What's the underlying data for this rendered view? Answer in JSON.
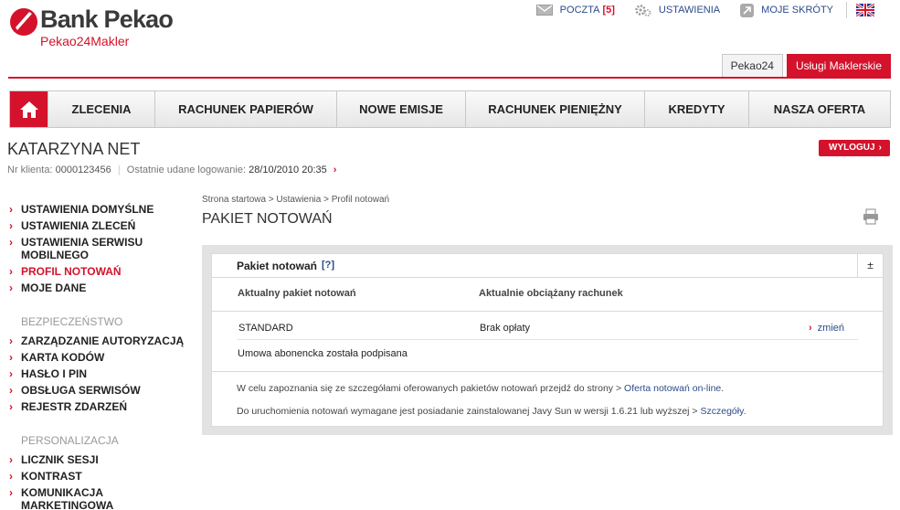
{
  "brand": {
    "name": "Bank Pekao",
    "subtitle": "Pekao24Makler",
    "color": "#d4122b"
  },
  "top_links": {
    "mail_label": "POCZTA",
    "mail_count": "[5]",
    "settings_label": "USTAWIENIA",
    "shortcuts_label": "MOJE SKRÓTY"
  },
  "site_tabs": [
    {
      "label": "Pekao24",
      "active": false
    },
    {
      "label": "Usługi Maklerskie",
      "active": true
    }
  ],
  "main_nav": [
    "ZLECENIA",
    "RACHUNEK PAPIERÓW",
    "NOWE EMISJE",
    "RACHUNEK PIENIĘŻNY",
    "KREDYTY",
    "NASZA OFERTA"
  ],
  "user": {
    "name": "KATARZYNA NET",
    "client_label": "Nr klienta:",
    "client_no": "0000123456",
    "last_login_label": "Ostatnie udane logowanie:",
    "last_login": "28/10/2010 20:35",
    "logout_label": "WYLOGUJ"
  },
  "sidebar": {
    "settings_items": [
      {
        "label": "USTAWIENIA DOMYŚLNE",
        "active": false
      },
      {
        "label": "USTAWIENIA ZLECEŃ",
        "active": false
      },
      {
        "label": "USTAWIENIA SERWISU MOBILNEGO",
        "active": false
      },
      {
        "label": "PROFIL NOTOWAŃ",
        "active": true
      },
      {
        "label": "MOJE DANE",
        "active": false
      }
    ],
    "security_heading": "BEZPIECZEŃSTWO",
    "security_items": [
      "ZARZĄDZANIE AUTORYZACJĄ",
      "KARTA KODÓW",
      "HASŁO I PIN",
      "OBSŁUGA SERWISÓW",
      "REJESTR ZDARZEŃ"
    ],
    "personal_heading": "PERSONALIZACJA",
    "personal_items": [
      "LICZNIK SESJI",
      "KONTRAST",
      "KOMUNIKACJA MARKETINGOWA"
    ]
  },
  "breadcrumb": "Strona startowa > Ustawienia > Profil notowań",
  "page_title": "PAKIET NOTOWAŃ",
  "panel": {
    "title": "Pakiet notowań",
    "help": "[?]",
    "collapse": "±",
    "col_package": "Aktualny pakiet notowań",
    "col_account": "Aktualnie obciążany rachunek",
    "package_value": "STANDARD",
    "account_value": "Brak opłaty",
    "change_label": "zmień",
    "contract_note": "Umowa abonencka została podpisana",
    "info1_text": "W celu zapoznania się ze szczegółami oferowanych pakietów notowań przejdź do strony >",
    "info1_link": "Oferta notowań on-line",
    "info2_text": "Do uruchomienia notowań wymagane jest posiadanie zainstalowanej Javy Sun w wersji 1.6.21 lub wyższej >",
    "info2_link": "Szczegóły"
  }
}
